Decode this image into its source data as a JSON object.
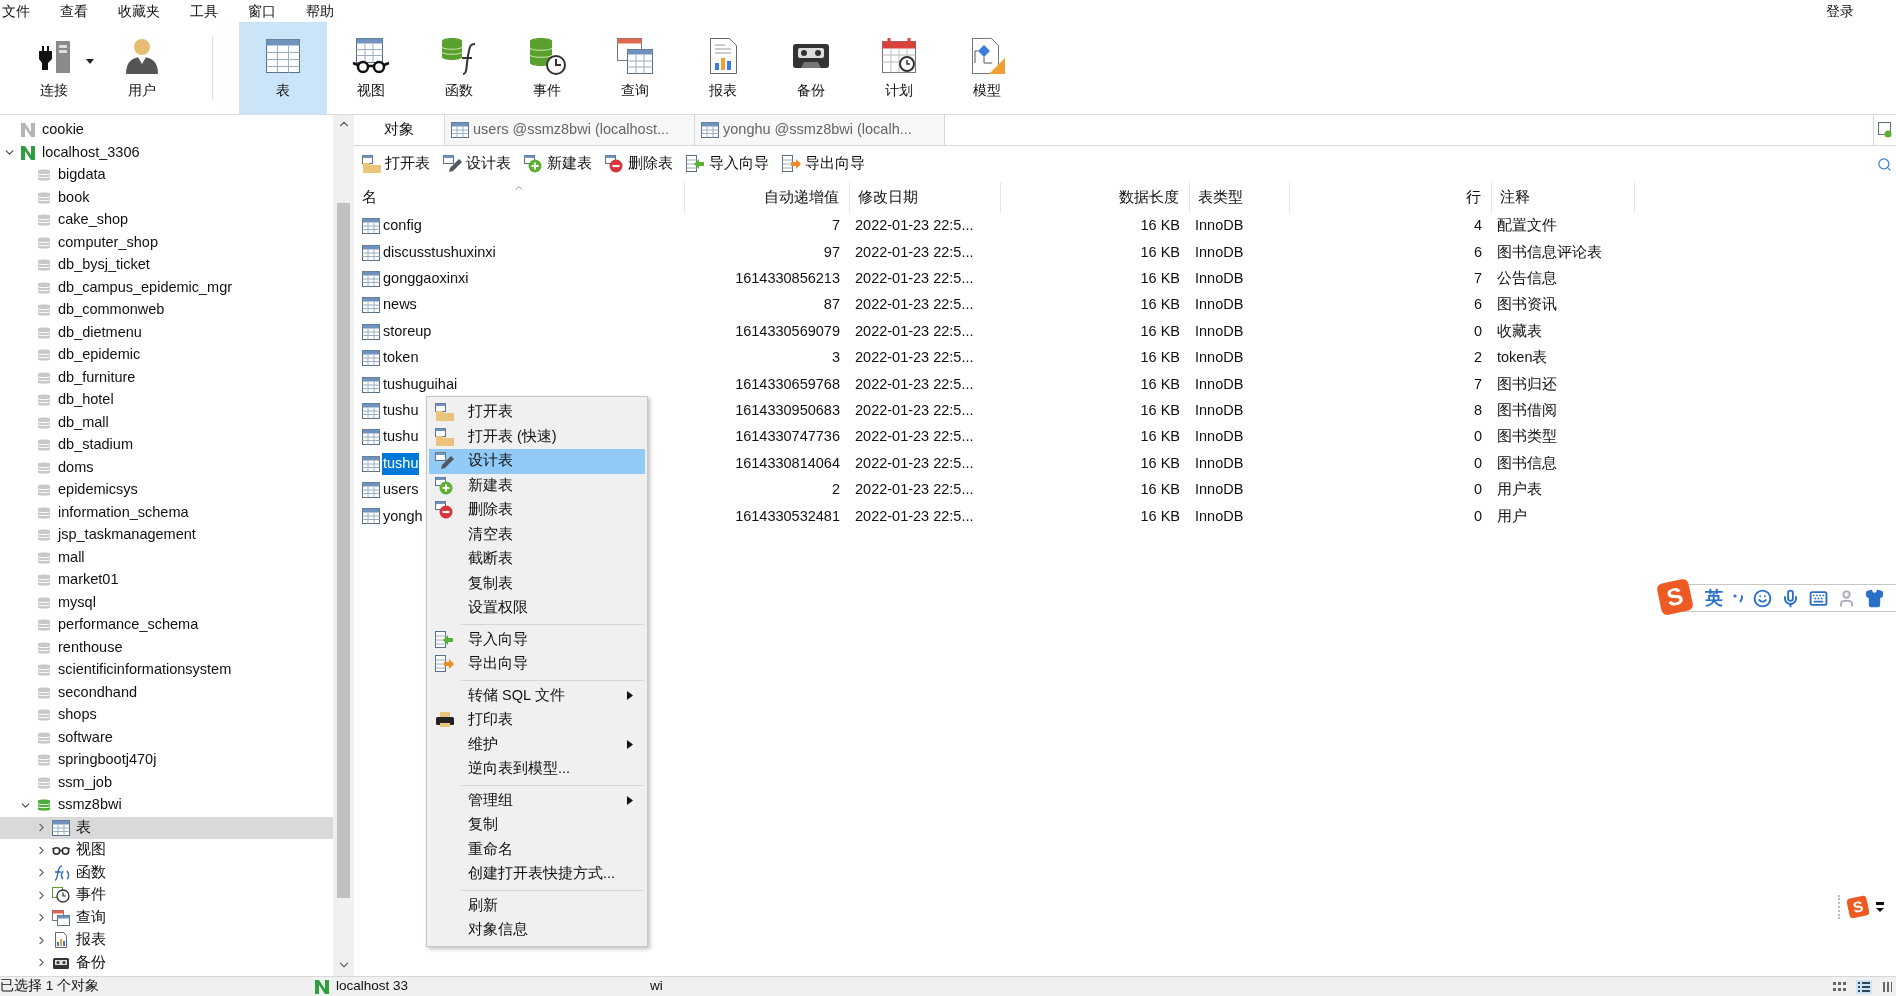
{
  "menu_bar": [
    "文件",
    "查看",
    "收藏夹",
    "工具",
    "窗口",
    "帮助"
  ],
  "login": "登录",
  "toolbar": [
    {
      "label": "连接",
      "selected": false,
      "dropdown": true
    },
    {
      "label": "用户",
      "selected": false,
      "dropdown": false
    },
    {
      "label": "表",
      "selected": true,
      "dropdown": false
    },
    {
      "label": "视图",
      "selected": false,
      "dropdown": false
    },
    {
      "label": "函数",
      "selected": false,
      "dropdown": false
    },
    {
      "label": "事件",
      "selected": false,
      "dropdown": false
    },
    {
      "label": "查询",
      "selected": false,
      "dropdown": false
    },
    {
      "label": "报表",
      "selected": false,
      "dropdown": false
    },
    {
      "label": "备份",
      "selected": false,
      "dropdown": false
    },
    {
      "label": "计划",
      "selected": false,
      "dropdown": false
    },
    {
      "label": "模型",
      "selected": false,
      "dropdown": false
    }
  ],
  "tree": [
    {
      "label": "cookie",
      "expanded": false,
      "selected": false
    },
    {
      "label": "localhost_3306",
      "expanded": true,
      "selected": false,
      "children": [
        {
          "label": "bigdata",
          "expanded": false,
          "selected": false
        },
        {
          "label": "book",
          "expanded": false,
          "selected": false
        },
        {
          "label": "cake_shop",
          "expanded": false,
          "selected": false
        },
        {
          "label": "computer_shop",
          "expanded": false,
          "selected": false
        },
        {
          "label": "db_bysj_ticket",
          "expanded": false,
          "selected": false
        },
        {
          "label": "db_campus_epidemic_mgr",
          "expanded": false,
          "selected": false
        },
        {
          "label": "db_commonweb",
          "expanded": false,
          "selected": false
        },
        {
          "label": "db_dietmenu",
          "expanded": false,
          "selected": false
        },
        {
          "label": "db_epidemic",
          "expanded": false,
          "selected": false
        },
        {
          "label": "db_furniture",
          "expanded": false,
          "selected": false
        },
        {
          "label": "db_hotel",
          "expanded": false,
          "selected": false
        },
        {
          "label": "db_mall",
          "expanded": false,
          "selected": false
        },
        {
          "label": "db_stadium",
          "expanded": false,
          "selected": false
        },
        {
          "label": "doms",
          "expanded": false,
          "selected": false
        },
        {
          "label": "epidemicsys",
          "expanded": false,
          "selected": false
        },
        {
          "label": "information_schema",
          "expanded": false,
          "selected": false
        },
        {
          "label": "jsp_taskmanagement",
          "expanded": false,
          "selected": false
        },
        {
          "label": "mall",
          "expanded": false,
          "selected": false
        },
        {
          "label": "market01",
          "expanded": false,
          "selected": false
        },
        {
          "label": "mysql",
          "expanded": false,
          "selected": false
        },
        {
          "label": "performance_schema",
          "expanded": false,
          "selected": false
        },
        {
          "label": "renthouse",
          "expanded": false,
          "selected": false
        },
        {
          "label": "scientificinformationsystem",
          "expanded": false,
          "selected": false
        },
        {
          "label": "secondhand",
          "expanded": false,
          "selected": false
        },
        {
          "label": "shops",
          "expanded": false,
          "selected": false
        },
        {
          "label": "software",
          "expanded": false,
          "selected": false
        },
        {
          "label": "springbootj470j",
          "expanded": false,
          "selected": false
        },
        {
          "label": "ssm_job",
          "expanded": false,
          "selected": false
        },
        {
          "label": "ssmz8bwi",
          "expanded": true,
          "selected": false,
          "children": [
            {
              "label": "表",
              "expanded": false,
              "selected": true
            },
            {
              "label": "视图",
              "expanded": false,
              "selected": false
            },
            {
              "label": "函数",
              "expanded": false,
              "selected": false
            },
            {
              "label": "事件",
              "expanded": false,
              "selected": false
            },
            {
              "label": "查询",
              "expanded": false,
              "selected": false
            },
            {
              "label": "报表",
              "expanded": false,
              "selected": false
            },
            {
              "label": "备份",
              "expanded": false,
              "selected": false
            }
          ]
        }
      ]
    }
  ],
  "tabs": [
    {
      "label": "对象",
      "selected": true
    },
    {
      "label": "users @ssmz8bwi (localhost...",
      "selected": false
    },
    {
      "label": "yonghu @ssmz8bwi (localh...",
      "selected": false
    }
  ],
  "object_toolbar": [
    "打开表",
    "设计表",
    "新建表",
    "删除表",
    "导入向导",
    "导出向导"
  ],
  "table": {
    "columns": [
      {
        "label": "名",
        "sorted": true
      },
      {
        "label": "自动递增值",
        "sorted": false
      },
      {
        "label": "修改日期",
        "sorted": false
      },
      {
        "label": "数据长度",
        "sorted": false
      },
      {
        "label": "表类型",
        "sorted": false
      },
      {
        "label": "行",
        "sorted": false
      },
      {
        "label": "注释",
        "sorted": false
      }
    ],
    "rows": [
      {
        "selected": false,
        "cells": [
          "config",
          "7",
          "2022-01-23 22:5...",
          "16 KB",
          "InnoDB",
          "4",
          "配置文件"
        ]
      },
      {
        "selected": false,
        "cells": [
          "discusstushuxinxi",
          "97",
          "2022-01-23 22:5...",
          "16 KB",
          "InnoDB",
          "6",
          "图书信息评论表"
        ]
      },
      {
        "selected": false,
        "cells": [
          "gonggaoxinxi",
          "1614330856213",
          "2022-01-23 22:5...",
          "16 KB",
          "InnoDB",
          "7",
          "公告信息"
        ]
      },
      {
        "selected": false,
        "cells": [
          "news",
          "87",
          "2022-01-23 22:5...",
          "16 KB",
          "InnoDB",
          "6",
          "图书资讯"
        ]
      },
      {
        "selected": false,
        "cells": [
          "storeup",
          "1614330569079",
          "2022-01-23 22:5...",
          "16 KB",
          "InnoDB",
          "0",
          "收藏表"
        ]
      },
      {
        "selected": false,
        "cells": [
          "token",
          "3",
          "2022-01-23 22:5...",
          "16 KB",
          "InnoDB",
          "2",
          "token表"
        ]
      },
      {
        "selected": false,
        "cells": [
          "tushuguihai",
          "1614330659768",
          "2022-01-23 22:5...",
          "16 KB",
          "InnoDB",
          "7",
          "图书归还"
        ]
      },
      {
        "selected": false,
        "cells": [
          "tushu",
          "1614330950683",
          "2022-01-23 22:5...",
          "16 KB",
          "InnoDB",
          "8",
          "图书借阅"
        ]
      },
      {
        "selected": false,
        "cells": [
          "tushu",
          "1614330747736",
          "2022-01-23 22:5...",
          "16 KB",
          "InnoDB",
          "0",
          "图书类型"
        ]
      },
      {
        "selected": true,
        "cells": [
          "tushu",
          "1614330814064",
          "2022-01-23 22:5...",
          "16 KB",
          "InnoDB",
          "0",
          "图书信息"
        ]
      },
      {
        "selected": false,
        "cells": [
          "users",
          "2",
          "2022-01-23 22:5...",
          "16 KB",
          "InnoDB",
          "0",
          "用户表"
        ]
      },
      {
        "selected": false,
        "cells": [
          "yongh",
          "1614330532481",
          "2022-01-23 22:5...",
          "16 KB",
          "InnoDB",
          "0",
          "用户"
        ]
      }
    ]
  },
  "context_menu": {
    "groups": [
      [
        {
          "label": "打开表",
          "selected": false,
          "submenu": false
        },
        {
          "label": "打开表 (快速)",
          "selected": false,
          "submenu": false
        },
        {
          "label": "设计表",
          "selected": true,
          "submenu": false
        },
        {
          "label": "新建表",
          "selected": false,
          "submenu": false
        },
        {
          "label": "删除表",
          "selected": false,
          "submenu": false
        },
        {
          "label": "清空表",
          "selected": false,
          "submenu": false
        },
        {
          "label": "截断表",
          "selected": false,
          "submenu": false
        },
        {
          "label": "复制表",
          "selected": false,
          "submenu": false
        },
        {
          "label": "设置权限",
          "selected": false,
          "submenu": false
        }
      ],
      [
        {
          "label": "导入向导",
          "selected": false,
          "submenu": false
        },
        {
          "label": "导出向导",
          "selected": false,
          "submenu": false
        }
      ],
      [
        {
          "label": "转储 SQL 文件",
          "selected": false,
          "submenu": true
        },
        {
          "label": "打印表",
          "selected": false,
          "submenu": false
        },
        {
          "label": "维护",
          "selected": false,
          "submenu": true
        },
        {
          "label": "逆向表到模型...",
          "selected": false,
          "submenu": false
        }
      ],
      [
        {
          "label": "管理组",
          "selected": false,
          "submenu": true
        },
        {
          "label": "复制",
          "selected": false,
          "submenu": false
        },
        {
          "label": "重命名",
          "selected": false,
          "submenu": false
        },
        {
          "label": "创建打开表快捷方式...",
          "selected": false,
          "submenu": false
        }
      ],
      [
        {
          "label": "刷新",
          "selected": false,
          "submenu": false
        },
        {
          "label": "对象信息",
          "selected": false,
          "submenu": false
        }
      ]
    ]
  },
  "status_bar": [
    "已选择 1 个对象",
    "localhost 33",
    "wi"
  ],
  "ime_bar": {
    "logo": "S",
    "mode": "英"
  },
  "ime_mini": {
    "logo": "S"
  }
}
